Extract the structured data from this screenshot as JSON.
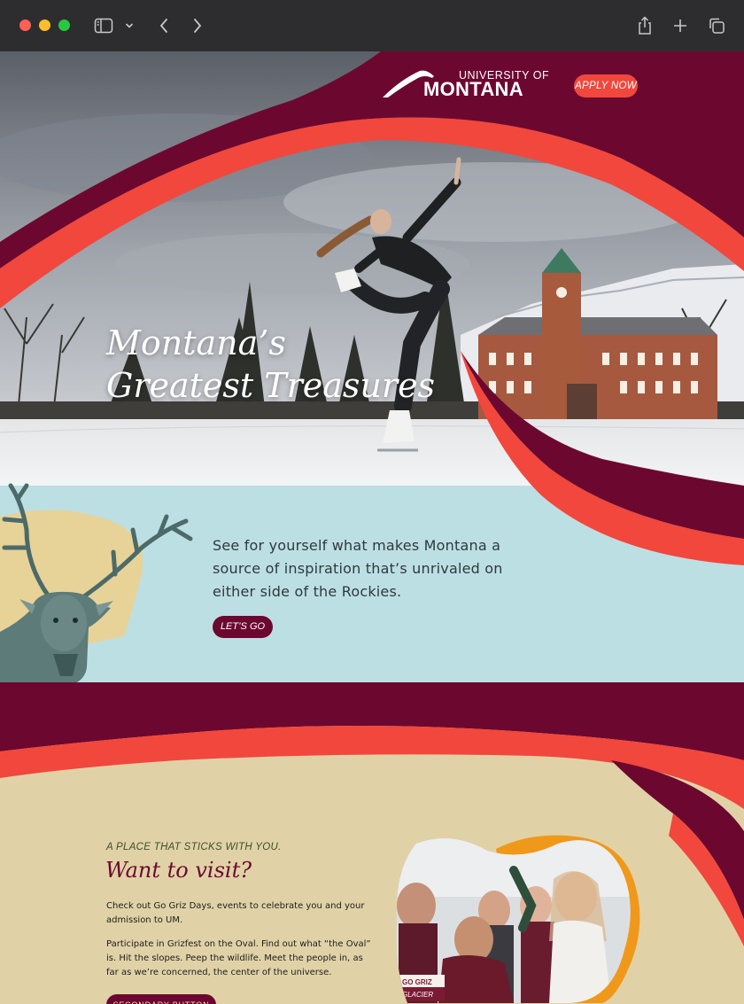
{
  "browser": {
    "controls": [
      "close",
      "minimize",
      "zoom"
    ],
    "toolbar_icons": [
      "sidebar-icon",
      "chevron-down-icon",
      "back-icon",
      "forward-icon",
      "share-icon",
      "new-tab-icon",
      "tabs-overview-icon"
    ]
  },
  "header": {
    "logo_small": "UNIVERSITY OF",
    "logo_main": "MONTANA",
    "apply_label": "APPLY NOW"
  },
  "hero": {
    "title_line1": "Montana’s",
    "title_line2": "Greatest Treasures"
  },
  "intro": {
    "text": "See for yourself what makes Montana a source of inspiration that’s unrivaled on either side of the Rockies.",
    "button_label": "LET’S GO"
  },
  "visit": {
    "eyebrow": "A PLACE THAT STICKS WITH YOU.",
    "title": "Want to visit?",
    "paragraph1": "Check out Go Griz Days, events to celebrate you and your admission to UM.",
    "paragraph2": "Participate in Grizfest on the Oval. Find out what “the Oval” is. Hit the slopes. Peep the wildlife. Meet the people in, as far as we’re concerned, the center of the universe.",
    "button_label": "SECONDARY BUTTON",
    "sign_text_top": "GO GRIZ",
    "sign_text_bottom": "GLACIER"
  },
  "colors": {
    "maroon": "#6c0830",
    "coral": "#f2473c",
    "sky_blue": "#bcdfe4",
    "tan": "#e0d2a6",
    "orange": "#f0981a"
  }
}
